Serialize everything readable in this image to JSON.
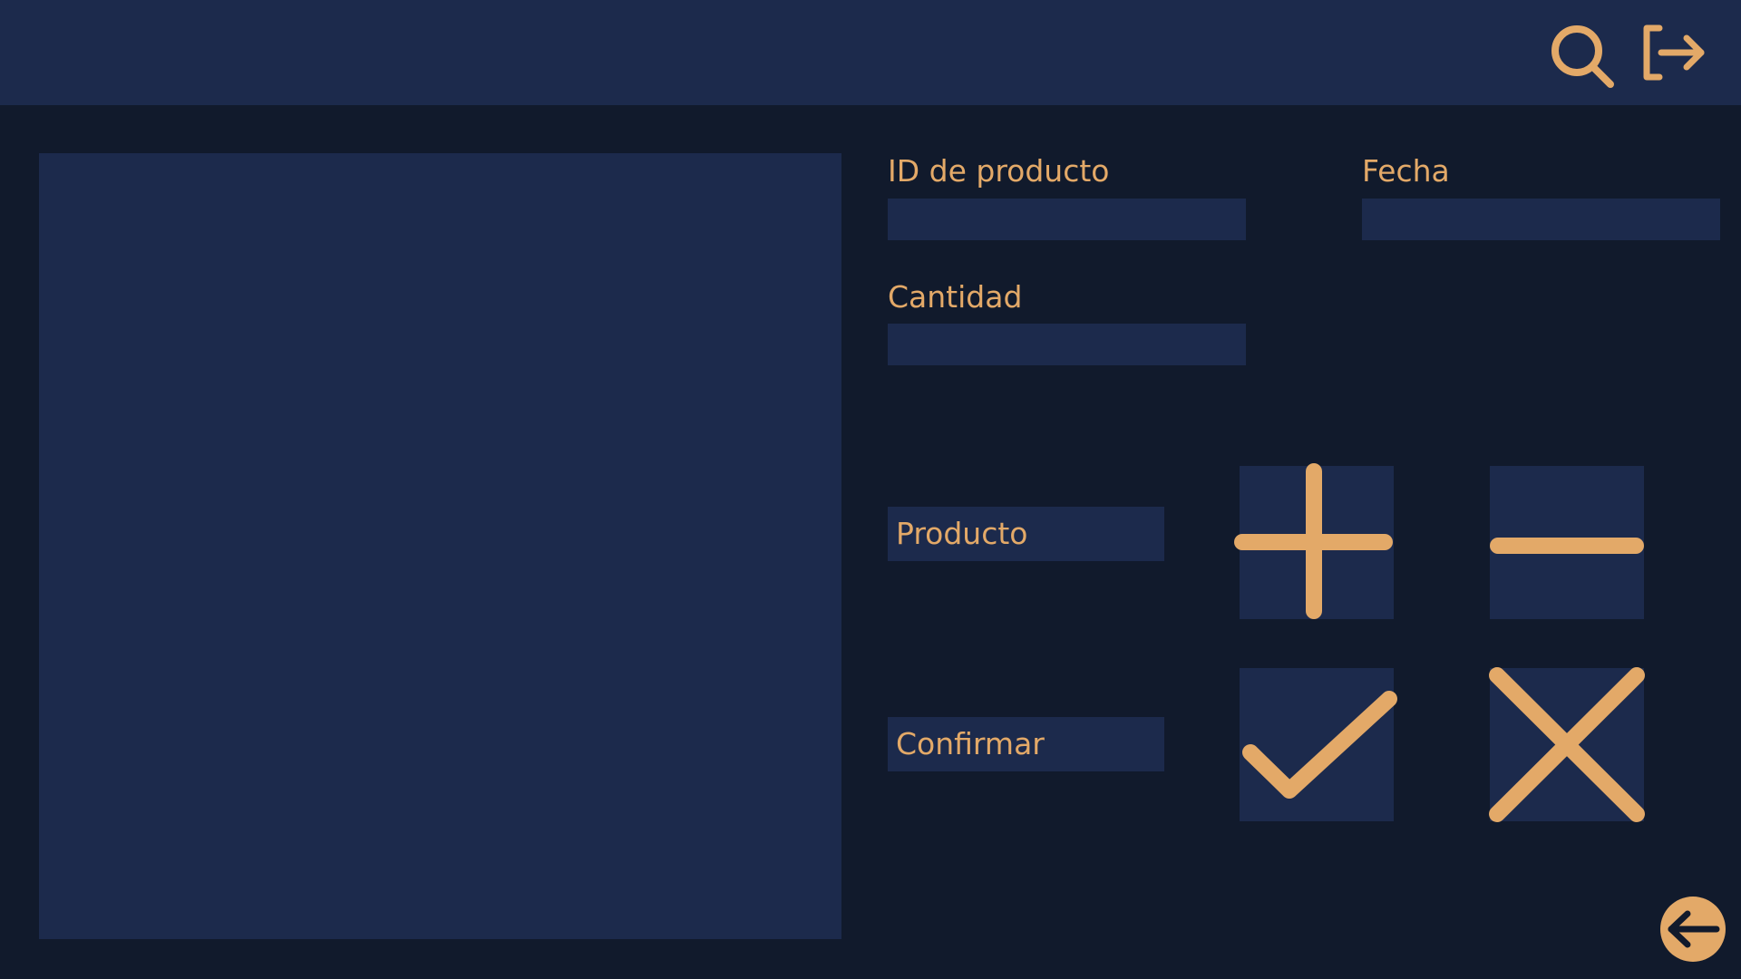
{
  "header": {
    "search_icon": "search-icon",
    "logout_icon": "logout-icon"
  },
  "form": {
    "product_id_label": "ID de producto",
    "product_id_value": "",
    "date_label": "Fecha",
    "date_value": "",
    "quantity_label": "Cantidad",
    "quantity_value": ""
  },
  "actions": {
    "product_label": "Producto",
    "confirm_label": "Confirmar",
    "add_icon": "plus-icon",
    "remove_icon": "minus-icon",
    "accept_icon": "check-icon",
    "cancel_icon": "close-icon",
    "back_icon": "arrow-left-icon"
  },
  "colors": {
    "background": "#111A2C",
    "panel": "#1C2A4C",
    "accent": "#E3A968"
  }
}
